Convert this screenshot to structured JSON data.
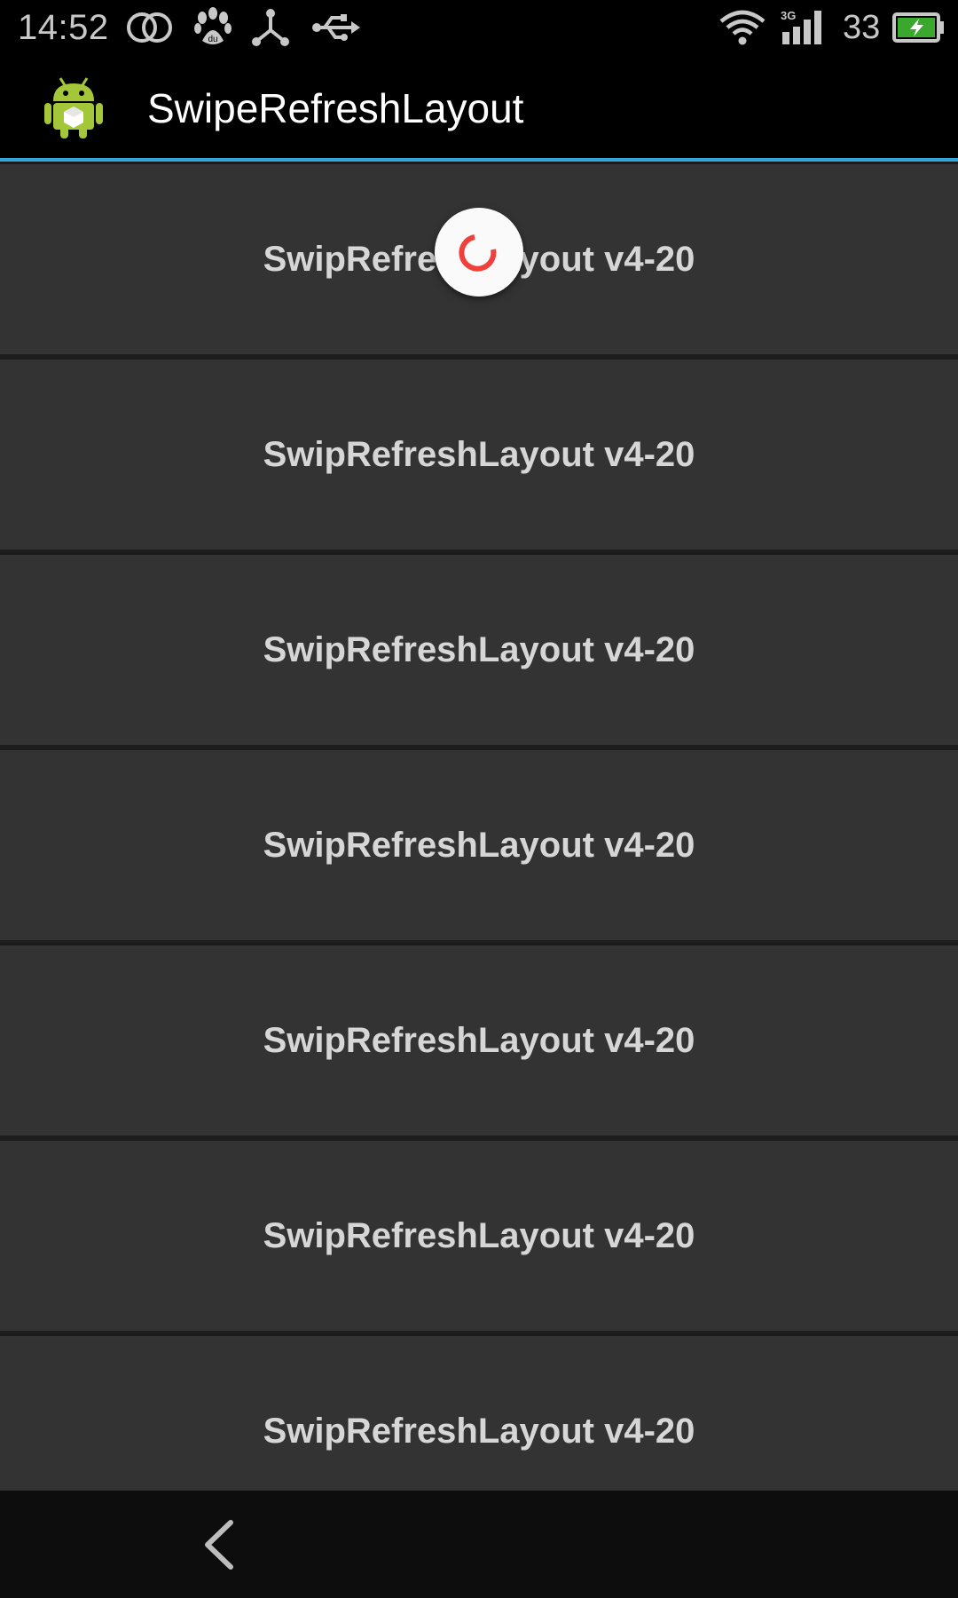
{
  "status_bar": {
    "time": "14:52",
    "battery_level": "33",
    "icons": [
      "dual-rings-icon",
      "baidu-paw-icon",
      "share-network-icon",
      "usb-icon",
      "wifi-icon",
      "signal-3g-icon",
      "battery-charging-icon"
    ],
    "network_type": "3G",
    "notification_paw_text": "du"
  },
  "action_bar": {
    "app_icon": "android-robot-icon",
    "title": "SwipeRefreshLayout"
  },
  "list": {
    "items": [
      {
        "label": "SwipRefreshLayout v4-20"
      },
      {
        "label": "SwipRefreshLayout v4-20"
      },
      {
        "label": "SwipRefreshLayout v4-20"
      },
      {
        "label": "SwipRefreshLayout v4-20"
      },
      {
        "label": "SwipRefreshLayout v4-20"
      },
      {
        "label": "SwipRefreshLayout v4-20"
      },
      {
        "label": "SwipRefreshLayout v4-20"
      }
    ]
  },
  "refresh_indicator": {
    "state": "refreshing",
    "color": "#f0403c"
  },
  "nav_bar": {
    "back_icon": "chevron-left-icon"
  },
  "colors": {
    "accent": "#35a4d6",
    "item_background": "#333333",
    "item_text": "#d6d6d6"
  }
}
